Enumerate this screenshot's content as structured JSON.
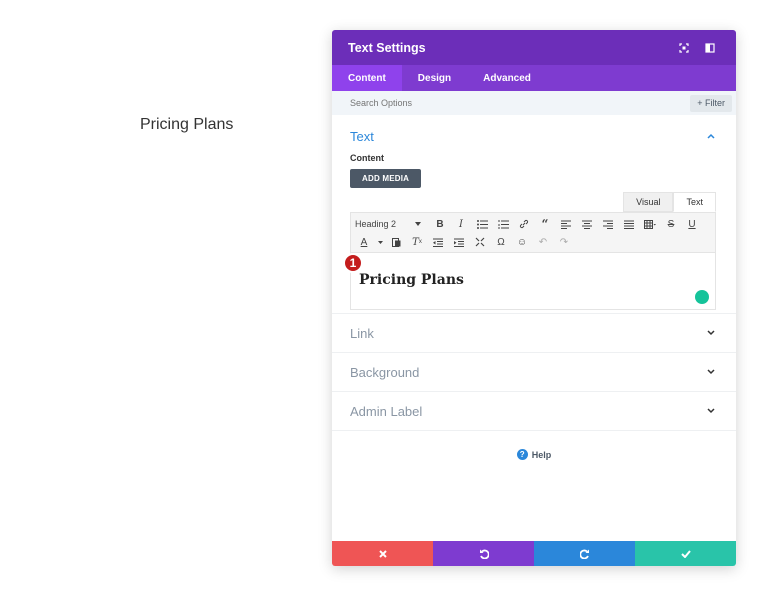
{
  "page": {
    "heading": "Pricing Plans"
  },
  "panel": {
    "title": "Text Settings",
    "header_icons": [
      "focus-icon",
      "sidebar-toggle-icon"
    ],
    "tabs": [
      {
        "label": "Content",
        "active": true
      },
      {
        "label": "Design",
        "active": false
      },
      {
        "label": "Advanced",
        "active": false
      }
    ],
    "search": {
      "placeholder": "Search Options",
      "value": ""
    },
    "filter_label": "+ Filter",
    "text_section": {
      "title": "Text",
      "content_label": "Content",
      "add_media_label": "ADD MEDIA",
      "editor_tabs": [
        "Visual",
        "Text"
      ],
      "active_editor_tab": "Text",
      "format_select": "Heading 2",
      "editor_content": "Pricing Plans",
      "step_badge": "1"
    },
    "sections": [
      "Link",
      "Background",
      "Admin Label"
    ],
    "help_label": "Help",
    "footer": [
      {
        "action": "discard",
        "icon": "close-icon",
        "color": "#ef5555"
      },
      {
        "action": "undo",
        "icon": "undo-icon",
        "color": "#7e3bd0"
      },
      {
        "action": "redo",
        "icon": "redo-icon",
        "color": "#2b87da"
      },
      {
        "action": "save",
        "icon": "check-icon",
        "color": "#29c4a9"
      }
    ]
  },
  "colors": {
    "header": "#6c2eb9",
    "tabs": "#7e3bd0",
    "accent": "#2b87da",
    "badge": "#c41d1d"
  }
}
